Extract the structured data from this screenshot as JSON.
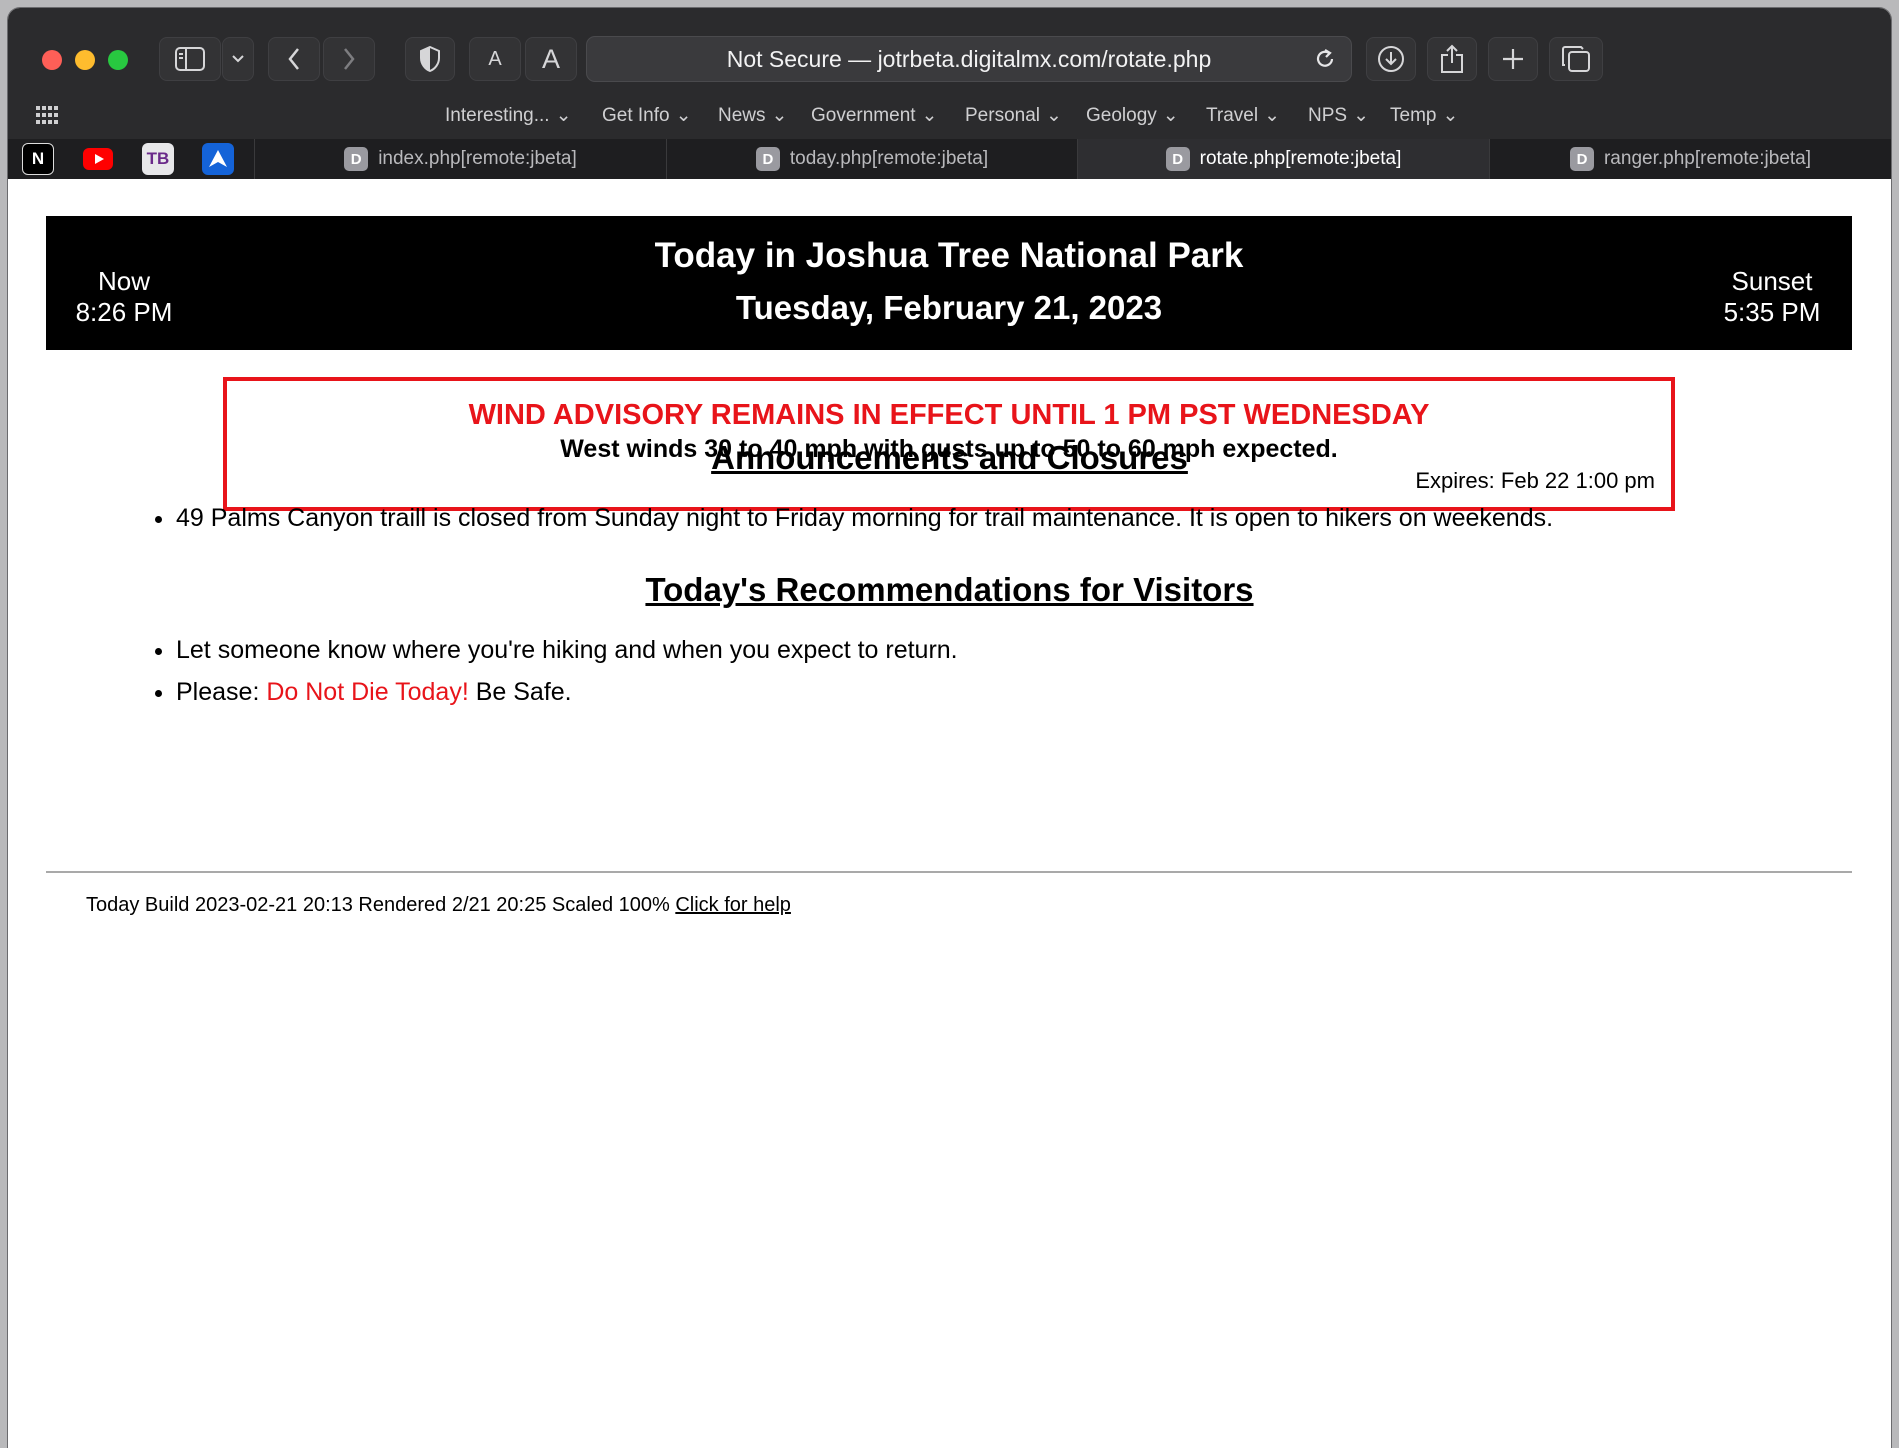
{
  "browser": {
    "address_text": "Not Secure — jotrbeta.digitalmx.com/rotate.php",
    "bookmarks": [
      "Interesting...",
      "Get Info",
      "News",
      "Government",
      "Personal",
      "Geology",
      "Travel",
      "NPS",
      "Temp"
    ],
    "pinned_tabs": [
      {
        "name": "notion",
        "icon": "N"
      },
      {
        "name": "youtube",
        "icon": "youtube-icon"
      },
      {
        "name": "tb",
        "icon": "TB"
      },
      {
        "name": "app-arrow",
        "icon": "arrow-icon"
      }
    ],
    "tabs": [
      {
        "label": "index.php[remote:jbeta]",
        "favicon": "D"
      },
      {
        "label": "today.php[remote:jbeta]",
        "favicon": "D"
      },
      {
        "label": "rotate.php[remote:jbeta]",
        "favicon": "D",
        "active": true
      },
      {
        "label": "ranger.php[remote:jbeta]",
        "favicon": "D"
      }
    ],
    "font_button_small": "A",
    "font_button_large": "A"
  },
  "page": {
    "banner": {
      "now_label": "Now",
      "now_time": "8:26 PM",
      "title": "Today in Joshua Tree National Park",
      "date": "Tuesday, February 21, 2023",
      "sunset_label": "Sunset",
      "sunset_time": "5:35 PM"
    },
    "advisory": {
      "headline": "WIND ADVISORY REMAINS IN EFFECT UNTIL 1 PM PST WEDNESDAY",
      "description": "West winds 30 to 40 mph with gusts up to 50 to 60 mph expected.",
      "expires": "Expires: Feb 22 1:00 pm",
      "color": "#e8141a"
    },
    "announcements": {
      "heading": "Announcements and Closures",
      "items": [
        "49 Palms Canyon traill is closed from Sunday night to Friday morning for trail maintenance. It is open to hikers on weekends."
      ]
    },
    "recommendations": {
      "heading": "Today's Recommendations for Visitors",
      "item1": "Let someone know where you're hiking and when you expect to return.",
      "item2_prefix": "Please: ",
      "item2_highlight": "Do Not Die Today!",
      "item2_suffix": " Be Safe."
    },
    "footer": {
      "text": "Today Build 2023-02-21 20:13 Rendered 2/21 20:25 Scaled 100% ",
      "help_link": "Click for help"
    }
  }
}
